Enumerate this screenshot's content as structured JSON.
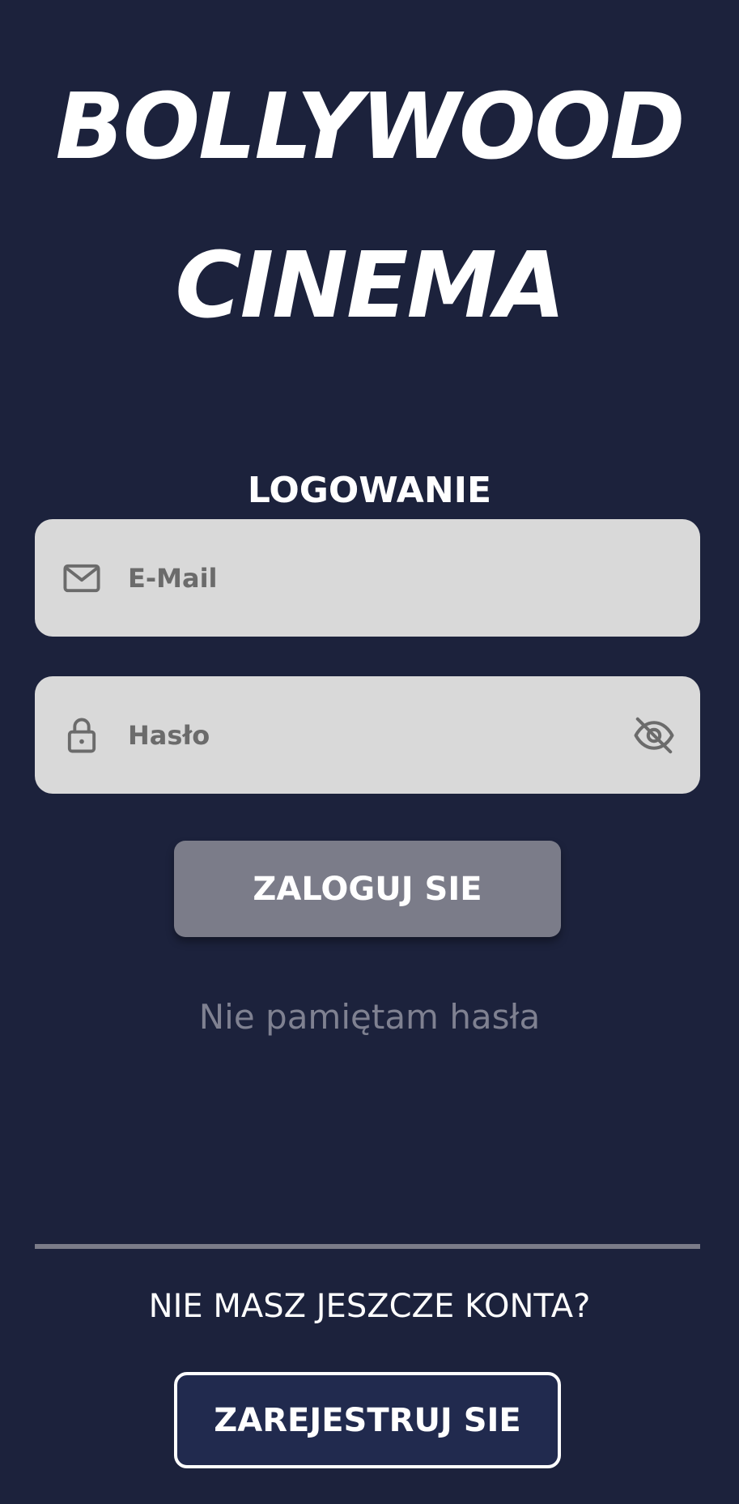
{
  "app": {
    "title_line1": "BOLLYWOOD",
    "title_line2": "CINEMA"
  },
  "login": {
    "heading": "LOGOWANIE",
    "email": {
      "placeholder": "E-Mail",
      "value": "",
      "icon": "mail-icon"
    },
    "password": {
      "placeholder": "Hasło",
      "value": "",
      "icon": "lock-icon",
      "toggle_icon": "eye-off-icon"
    },
    "submit_label": "ZALOGUJ SIE",
    "forgot_label": "Nie pamiętam hasła"
  },
  "register": {
    "prompt": "NIE MASZ JESZCZE KONTA?",
    "button_label": "ZAREJESTRUJ SIE"
  },
  "colors": {
    "background": "#1c223c",
    "field_background": "#d9d9d9",
    "primary_button": "#7b7c89",
    "secondary_button": "#212a4e",
    "muted_text": "#7f8191"
  }
}
